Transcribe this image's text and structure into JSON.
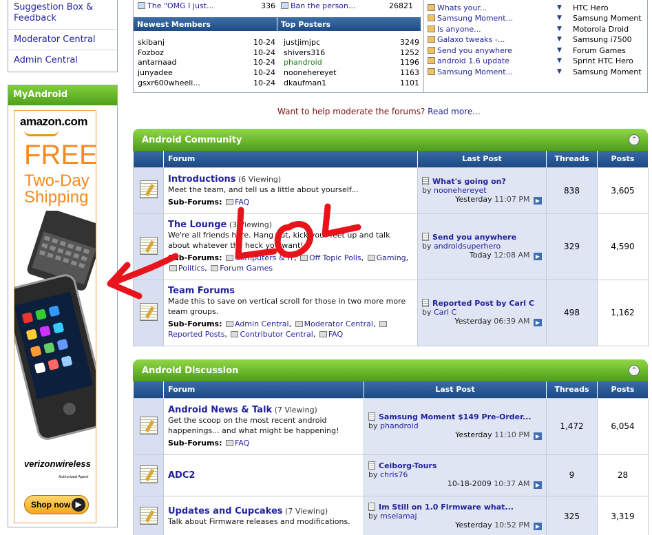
{
  "sidebar": {
    "links": [
      "Suggestion Box & Feedback",
      "Moderator Central",
      "Admin Central"
    ]
  },
  "myandroid": {
    "title": "MyAndroid",
    "ad": {
      "brand": "amazon.com",
      "free": "FREE",
      "shipping_line1": "Two-Day",
      "shipping_line2": "Shipping",
      "carrier": "verizonwireless",
      "carrier_sub": "Authorized Agent",
      "shop": "Shop now"
    }
  },
  "stats": {
    "top_row": [
      {
        "title": "The \"OMG I just...",
        "count": "336"
      },
      {
        "title": "Ban the person...",
        "count": "26821"
      }
    ],
    "newest_members_heading": "Newest Members",
    "top_posters_heading": "Top Posters",
    "newest_members": [
      {
        "name": "skibanj",
        "date": "10-24"
      },
      {
        "name": "Fozboz",
        "date": "10-24"
      },
      {
        "name": "antarnaad",
        "date": "10-24"
      },
      {
        "name": "junyadee",
        "date": "10-24"
      },
      {
        "name": "gsxr600wheeli...",
        "date": "10-24"
      }
    ],
    "top_posters": [
      {
        "name": "justjimjpc",
        "count": "3249"
      },
      {
        "name": "shivers316",
        "count": "1252"
      },
      {
        "name": "phandroid",
        "count": "1196"
      },
      {
        "name": "noonehereyet",
        "count": "1163"
      },
      {
        "name": "dkaufman1",
        "count": "1101"
      }
    ],
    "latest_threads": [
      "Whats your...",
      "Samsung Moment...",
      "Is anyone...",
      "Galaxo tweaks -...",
      "Send you anywhere",
      "android 1.6 update",
      "Samsung Moment..."
    ],
    "latest_forums": [
      "HTC Hero",
      "Samsung Moment",
      "Motorola Droid",
      "Samsung i7500",
      "Forum Games",
      "Sprint HTC Hero",
      "Samsung Moment"
    ]
  },
  "help_text": {
    "prefix": "Want to help moderate the forums?",
    "link": "Read more..."
  },
  "headers": {
    "forum": "Forum",
    "last_post": "Last Post",
    "threads": "Threads",
    "posts": "Posts"
  },
  "labels": {
    "sub_forums": "Sub-Forums:",
    "by": "by"
  },
  "sections": [
    {
      "title": "Android Community",
      "forums": [
        {
          "name": "Introductions",
          "viewing": "(6 Viewing)",
          "desc": "Meet the team, and tell us a little about yourself...",
          "subforums": [
            "FAQ"
          ],
          "last_title": "What's going on?",
          "last_by": "noonehereyet",
          "last_day": "Yesterday",
          "last_time": "11:07 PM",
          "threads": "838",
          "posts": "3,605"
        },
        {
          "name": "The Lounge",
          "viewing": "(3 Viewing)",
          "desc": "We're all friends here. Hang out, kick your feet up and talk about whatever the heck you want!",
          "subforums": [
            "Computers & IT",
            "Off Topic Polls",
            "Gaming",
            "Politics",
            "Forum Games"
          ],
          "last_title": "Send you anywhere",
          "last_by": "androidsuperhero",
          "last_day": "Today",
          "last_time": "12:08 AM",
          "threads": "329",
          "posts": "4,590"
        },
        {
          "name": "Team Forums",
          "viewing": "",
          "desc": "Made this to save on vertical scroll for those in two more more team groups.",
          "subforums": [
            "Admin Central",
            "Moderator Central",
            "Reported Posts",
            "Contributor Central",
            "FAQ"
          ],
          "last_title": "Reported Post by Carl C",
          "last_by": "Carl C",
          "last_day": "Yesterday",
          "last_time": "06:39 AM",
          "threads": "498",
          "posts": "1,162"
        }
      ]
    },
    {
      "title": "Android Discussion",
      "forums": [
        {
          "name": "Android News & Talk",
          "viewing": "(7 Viewing)",
          "desc": "Get the scoop on the most recent android happenings... and what might be happening!",
          "subforums": [
            "FAQ"
          ],
          "last_title": "Samsung Moment $149 Pre-Order...",
          "last_by": "phandroid",
          "last_day": "Yesterday",
          "last_time": "11:10 PM",
          "threads": "1,472",
          "posts": "6,054"
        },
        {
          "name": "ADC2",
          "viewing": "",
          "desc": "",
          "subforums": [],
          "last_title": "Ceiborg-Tours",
          "last_by": "chris76",
          "last_day": "10-18-2009",
          "last_time": "10:37 AM",
          "threads": "9",
          "posts": "28"
        },
        {
          "name": "Updates and Cupcakes",
          "viewing": "(7 Viewing)",
          "desc": "Talk about Firmware releases and modifications.",
          "subforums": [],
          "last_title": "Im Still on 1.0 Firmware what...",
          "last_by": "mselamaj",
          "last_day": "Yesterday",
          "last_time": "10:52 PM",
          "threads": "325",
          "posts": "3,319"
        }
      ]
    }
  ],
  "annotation": {
    "text": "LOL",
    "color": "#e8141b"
  }
}
